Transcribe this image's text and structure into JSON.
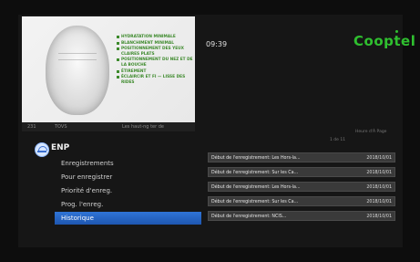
{
  "header": {
    "time": "09:39",
    "brand": "Cooptel",
    "hint": "Heure d'À Page"
  },
  "preview": {
    "list": [
      "Hydratation minimale",
      "Blanchiment minimal",
      "Positionnement des yeux claires plats",
      "Positionnement du nez et de la bouche",
      "Étirement",
      "Éclaircir et fi — lisse des rides"
    ],
    "strip": {
      "channel": "231",
      "code": "TOVS",
      "program": "Les haut-ng ter de"
    }
  },
  "epg": {
    "title": "ENP",
    "menu": [
      "Enregistrements",
      "Pour enregistrer",
      "Priorité d'enreg.",
      "Prog. l'enreg.",
      "Historique"
    ],
    "selected_index": 4
  },
  "history": {
    "page": "1 de 11",
    "rows": [
      {
        "text": "Début de l'enregistrement: Les Hors-la...",
        "date": "2018/10/01"
      },
      {
        "text": "Début de l'enregistrement: Sur les Ca...",
        "date": "2018/10/01"
      },
      {
        "text": "Début de l'enregistrement: Les Hors-la...",
        "date": "2018/10/01"
      },
      {
        "text": "Début de l'enregistrement: Sur les Ca...",
        "date": "2018/10/01"
      },
      {
        "text": "Début de l'enregistrement: NCIS...",
        "date": "2018/10/01"
      }
    ]
  },
  "colors": {
    "brand": "#2fbf2f",
    "selection": "#2f74d6",
    "row_bg": "#3a3a3a"
  }
}
